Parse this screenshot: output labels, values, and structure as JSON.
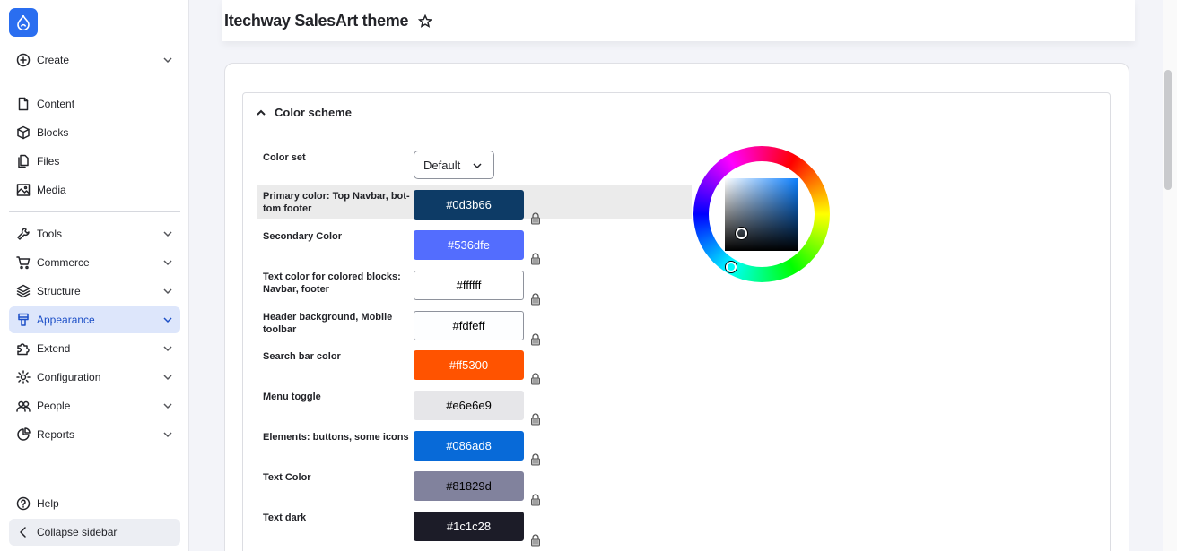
{
  "page": {
    "title": "Itechway SalesArt theme"
  },
  "sidebar": {
    "create": "Create",
    "content": "Content",
    "blocks": "Blocks",
    "files": "Files",
    "media": "Media",
    "tools": "Tools",
    "commerce": "Commerce",
    "structure": "Structure",
    "appearance": "Appearance",
    "extend": "Extend",
    "configuration": "Configuration",
    "people": "People",
    "reports": "Reports",
    "help": "Help",
    "collapse": "Collapse sidebar"
  },
  "color_scheme": {
    "title": "Color scheme",
    "color_set_label": "Color set",
    "color_set_value": "Default",
    "fields": [
      {
        "label": "Primary color: Top Navbar, bot-tom footer",
        "value": "#0d3b66",
        "bg": "#0d3b66",
        "fg": "#ffffff"
      },
      {
        "label": "Secondary Color",
        "value": "#536dfe",
        "bg": "#536dfe",
        "fg": "#ffffff"
      },
      {
        "label": "Text color for colored blocks: Navbar, footer",
        "value": "#ffffff",
        "bg": "#ffffff",
        "fg": "#000000"
      },
      {
        "label": "Header background, Mobile toolbar",
        "value": "#fdfeff",
        "bg": "#fdfeff",
        "fg": "#000000"
      },
      {
        "label": "Search bar color",
        "value": "#ff5300",
        "bg": "#ff5300",
        "fg": "#ffffff"
      },
      {
        "label": "Menu toggle",
        "value": "#e6e6e9",
        "bg": "#e6e6e9",
        "fg": "#000000"
      },
      {
        "label": "Elements: buttons, some icons",
        "value": "#086ad8",
        "bg": "#086ad8",
        "fg": "#ffffff"
      },
      {
        "label": "Text Color",
        "value": "#81829d",
        "bg": "#81829d",
        "fg": "#000000"
      },
      {
        "label": "Text dark",
        "value": "#1c1c28",
        "bg": "#1c1c28",
        "fg": "#ffffff"
      }
    ]
  },
  "icons": {
    "logo": "drupal-drop-icon",
    "favorite": "star-icon",
    "lock": "lock-icon"
  },
  "colors": {
    "accent": "#2a6ef0",
    "active_bg": "#dde6fb",
    "active_fg": "#1c4fc7"
  }
}
